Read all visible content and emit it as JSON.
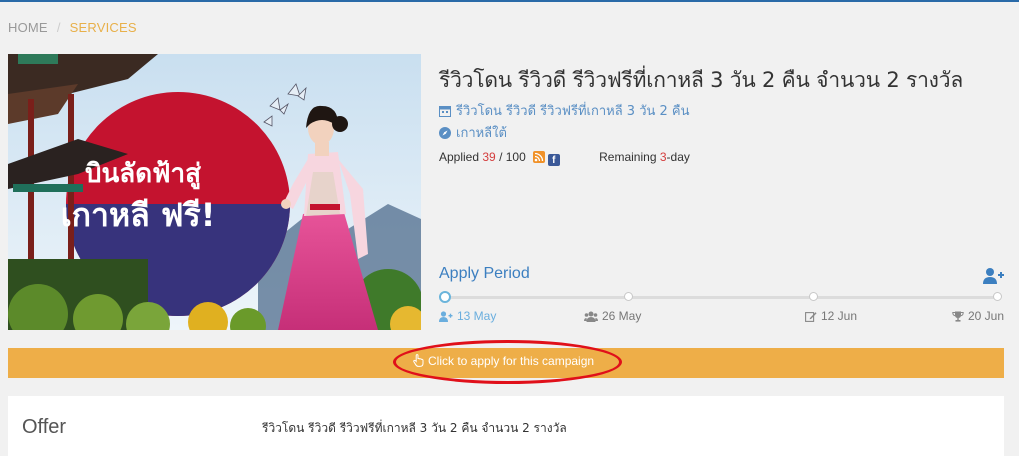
{
  "breadcrumb": {
    "home": "HOME",
    "separator": "/",
    "current": "SERVICES"
  },
  "banner": {
    "line1": "บินลัดฟ้าสู่",
    "line2": "เกาหลี ฟรี!"
  },
  "campaign": {
    "title": "รีวิวโดน รีวิวดี รีวิวฟรีที่เกาหลี 3 วัน 2 คืน จำนวน 2 รางวัล",
    "subtitle": "รีวิวโดน รีวิวดี รีวิวฟรีที่เกาหลี 3 วัน 2 คืน",
    "location": "เกาหลีใต้",
    "applied_label": "Applied",
    "applied_count": "39",
    "applied_total": "/ 100",
    "remaining_label": "Remaining",
    "remaining_value": "3",
    "remaining_unit": "-day"
  },
  "period": {
    "title": "Apply Period",
    "milestones": [
      {
        "icon": "user-plus-icon",
        "date": "13 May"
      },
      {
        "icon": "users-icon",
        "date": "26 May"
      },
      {
        "icon": "edit-icon",
        "date": "12 Jun"
      },
      {
        "icon": "trophy-icon",
        "date": "20 Jun"
      }
    ]
  },
  "apply_button": {
    "label": "Click to apply for this campaign"
  },
  "offer": {
    "title": "Offer",
    "text": "รีวิวโดน รีวิวดี รีวิวฟรีที่เกาหลี 3 วัน 2 คืน จำนวน 2 รางวัล"
  },
  "colors": {
    "accent": "#eeae48",
    "link": "#3c7fc0",
    "highlight": "#d43d3d",
    "annotation": "#e0101a"
  }
}
